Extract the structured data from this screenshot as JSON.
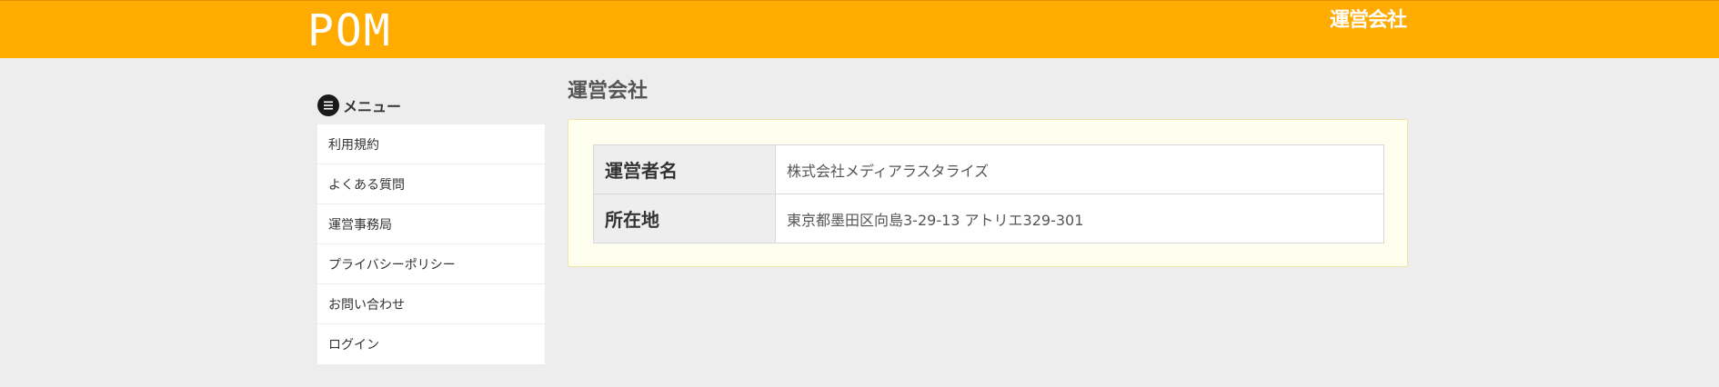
{
  "header": {
    "logo": "POM",
    "link_label": "運営会社",
    "background_color": "#ffab00"
  },
  "sidebar": {
    "heading": "メニュー",
    "heading_icon": "menu-icon",
    "items": [
      {
        "label": "利用規約"
      },
      {
        "label": "よくある質問"
      },
      {
        "label": "運営事務局"
      },
      {
        "label": "プライバシーポリシー"
      },
      {
        "label": "お問い合わせ"
      },
      {
        "label": "ログイン"
      }
    ]
  },
  "main": {
    "title": "運営会社",
    "table": {
      "rows": [
        {
          "label": "運営者名",
          "value": "株式会社メディアラスタライズ"
        },
        {
          "label": "所在地",
          "value": "東京都墨田区向島3-29-13 アトリエ329-301"
        }
      ]
    }
  }
}
